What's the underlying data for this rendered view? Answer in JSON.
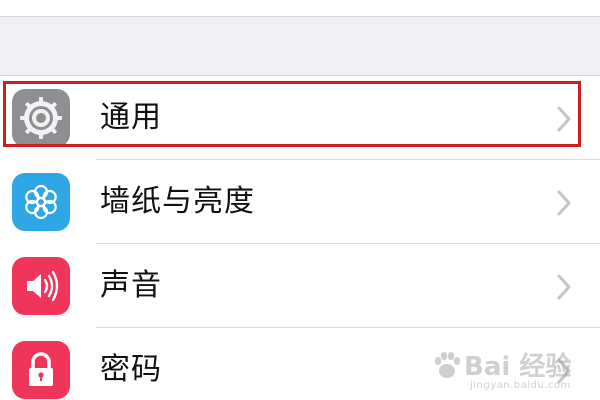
{
  "settings": {
    "items": [
      {
        "label": "通用",
        "icon": "gear-icon",
        "icon_color": "#8e8e93",
        "selected": true
      },
      {
        "label": "墙纸与亮度",
        "icon": "flower-icon",
        "icon_color": "#2fa6e6",
        "selected": false
      },
      {
        "label": "声音",
        "icon": "speaker-icon",
        "icon_color": "#f0355a",
        "selected": false
      },
      {
        "label": "密码",
        "icon": "lock-icon",
        "icon_color": "#f0355a",
        "selected": false
      }
    ]
  },
  "highlight_color": "#cc2020",
  "watermark": {
    "brand": "Bai 经验",
    "url": "jingyan.baidu.com"
  }
}
